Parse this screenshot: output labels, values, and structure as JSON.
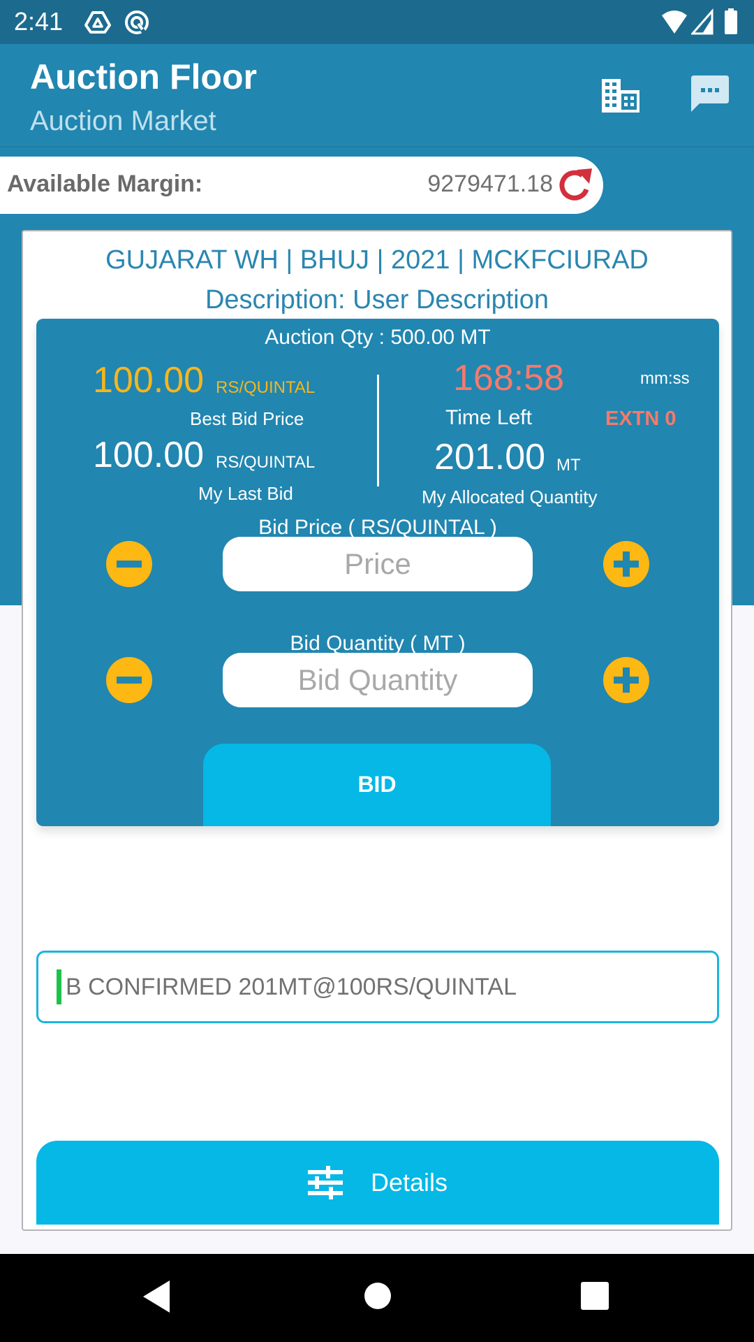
{
  "status_bar": {
    "time": "2:41",
    "left_icons": [
      "drive-icon",
      "quick-settings-icon"
    ],
    "right_icons": [
      "wifi-icon",
      "signal-icon",
      "battery-icon"
    ]
  },
  "appbar": {
    "title": "Auction Floor",
    "subtitle": "Auction Market",
    "actions": [
      "building-icon",
      "chat-icon"
    ]
  },
  "margin": {
    "label": "Available Margin:",
    "value": "9279471.18",
    "refresh_icon": "refresh-icon"
  },
  "lot": {
    "title": "GUJARAT WH | BHUJ | 2021 | MCKFCIURAD",
    "description": "Description: User Description"
  },
  "panel": {
    "auction_qty": "Auction Qty : 500.00 MT",
    "best_bid": {
      "value": "100.00",
      "unit": "RS/QUINTAL",
      "label": "Best Bid Price"
    },
    "last_bid": {
      "value": "100.00",
      "unit": "RS/QUINTAL",
      "label": "My Last Bid"
    },
    "time_left": {
      "value": "168:58",
      "format": "mm:ss",
      "label": "Time Left",
      "extension": "EXTN 0"
    },
    "allocated": {
      "value": "201.00",
      "unit": "MT",
      "label": "My Allocated Quantity"
    },
    "bid_price": {
      "label": "Bid Price  ( RS/QUINTAL )",
      "placeholder": "Price",
      "value": ""
    },
    "bid_quantity": {
      "label": "Bid Quantity ( MT )",
      "placeholder": "Bid Quantity",
      "value": ""
    },
    "bid_button": "BID"
  },
  "message": "B CONFIRMED 201MT@100RS/QUINTAL",
  "details_button": {
    "label": "Details",
    "icon": "tune-icon"
  },
  "colors": {
    "primary": "#2186b0",
    "status_bar": "#1c6b8e",
    "accent_button": "#05b8e6",
    "best_bid": "#f6b61c",
    "timer": "#f57a6c",
    "stepper": "#fdb813",
    "refresh": "#d32f3c",
    "message_indicator": "#1dc24a"
  }
}
